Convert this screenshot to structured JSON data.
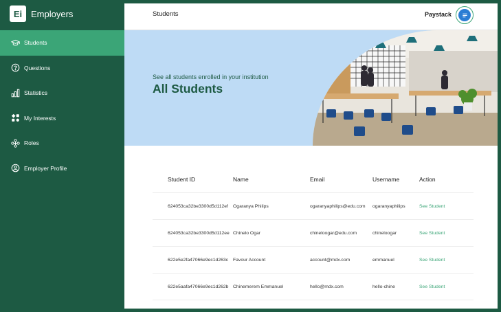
{
  "app": {
    "logo": "Ei",
    "name": "Employers"
  },
  "sidebar": {
    "items": [
      {
        "label": "Students",
        "icon": "graduation-cap-icon",
        "active": true
      },
      {
        "label": "Questions",
        "icon": "question-circle-icon",
        "active": false
      },
      {
        "label": "Statistics",
        "icon": "bar-chart-icon",
        "active": false
      },
      {
        "label": "My Interests",
        "icon": "apps-icon",
        "active": false
      },
      {
        "label": "Roles",
        "icon": "network-icon",
        "active": false
      },
      {
        "label": "Employer Profile",
        "icon": "user-circle-icon",
        "active": false
      }
    ]
  },
  "header": {
    "title": "Students",
    "company": "Paystack"
  },
  "hero": {
    "subtitle": "See all students enrolled in your institution",
    "title": "All Students"
  },
  "table": {
    "columns": [
      "Student ID",
      "Name",
      "Email",
      "Username",
      "Action"
    ],
    "rows": [
      {
        "id": "624053ca32be3300d5d112ef",
        "name": "Ogaranya Philips",
        "email": "ogaranyaphilips@edu.com",
        "username": "ogaranyaphilips",
        "action": "See Student"
      },
      {
        "id": "624053ca32be3300d5d112ee",
        "name": "Chinelo Ogar",
        "email": "chineloogar@edu.com",
        "username": "chineloogar",
        "action": "See Student"
      },
      {
        "id": "622e5e2fa47066e9ec1d263c",
        "name": "Favour Account",
        "email": "account@mdx.com",
        "username": "emmanuel",
        "action": "See Student"
      },
      {
        "id": "622e5aafa47066e9ec1d262b",
        "name": "Chinemerem Emmanuel",
        "email": "hello@mdx.com",
        "username": "hello-chine",
        "action": "See Student"
      }
    ]
  },
  "colors": {
    "primary": "#1d5a43",
    "accent": "#3ba577",
    "hero_bg": "#bedbf5",
    "menu_blue": "#2a7dd4"
  }
}
